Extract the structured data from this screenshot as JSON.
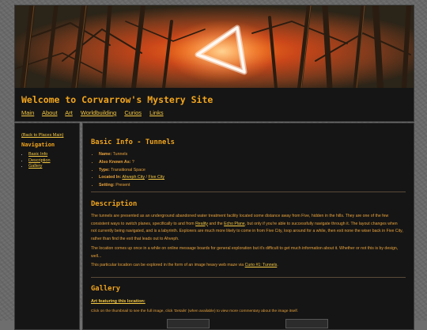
{
  "header": {
    "title": "Welcome to Corvarrow's Mystery Site",
    "nav": [
      "Main",
      "About",
      "Art",
      "Worldbuilding",
      "Curios",
      "Links"
    ]
  },
  "sidebar": {
    "back_link": "(Back to Places Main)",
    "heading": "Navigation",
    "items": [
      "Basic Info",
      "Description",
      "Gallery"
    ]
  },
  "basic_info": {
    "title": "Basic Info - Tunnels",
    "name_label": "Name:",
    "name_value": "Tunnels",
    "aka_label": "Also Known As:",
    "aka_value": "?",
    "type_label": "Type:",
    "type_value": "Transitional Space",
    "located_label": "Located In:",
    "located_link1": "Ahveph City",
    "located_sep": "/",
    "located_link2": "Five City",
    "setting_label": "Setting:",
    "setting_value": "Present"
  },
  "description": {
    "title": "Description",
    "p1_a": "The tunnels are presented as an underground abandoned water treatment facility located some distance away from Five, hidden in the hills. They are one of the few consistent ways to switch planes, specifically to and from ",
    "p1_link1": "Reality",
    "p1_b": " and the ",
    "p1_link2": "Echo Plane",
    "p1_c": ", but only if you're able to successfully navigate through it. The layout changes when not currently being navigated, and is a labyrinth. Explorers are much more likely to come in from Five City, loop around for a while, then exit none the wiser back in Five City, rather than find the exit that leads out to Ahveph.",
    "p2": "The location comes up once in a while on online message boards for general exploration but it's difficult to get much information about it. Whether or not this is by design, well...",
    "p3_a": "This particular location can be explored in the form of an image heavy web maze via ",
    "p3_link": "Curio #1: Tunnels",
    "p3_b": "."
  },
  "gallery": {
    "title": "Gallery",
    "art_heading": "Art featuring this location:",
    "note": "Click on the thumbnail to see the full image, click 'Details' (when available) to view more commentary about the image itself."
  },
  "colors": {
    "accent": "#f2a51c",
    "link": "#f5c842",
    "panel": "#151515",
    "background": "#6e6e6e"
  }
}
